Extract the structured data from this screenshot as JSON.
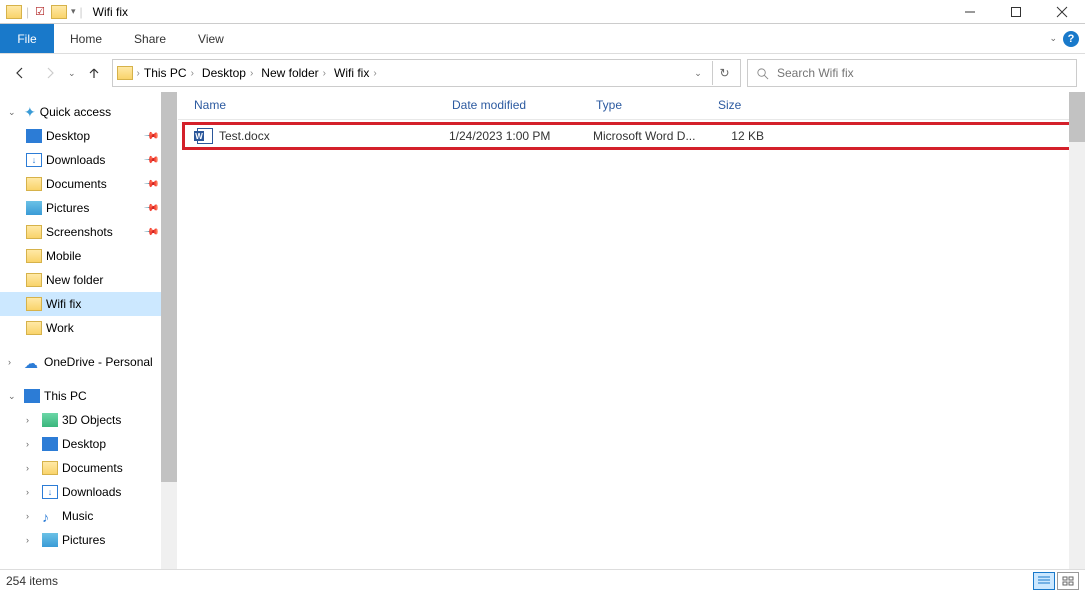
{
  "title": "Wifi fix",
  "ribbon": {
    "file": "File",
    "home": "Home",
    "share": "Share",
    "view": "View"
  },
  "breadcrumbs": [
    "This PC",
    "Desktop",
    "New folder",
    "Wifi fix"
  ],
  "search_placeholder": "Search Wifi fix",
  "columns": {
    "name": "Name",
    "date": "Date modified",
    "type": "Type",
    "size": "Size"
  },
  "files": [
    {
      "name": "Test.docx",
      "date": "1/24/2023 1:00 PM",
      "type": "Microsoft Word D...",
      "size": "12 KB"
    }
  ],
  "nav": {
    "quick_access": "Quick access",
    "qa": {
      "desktop": "Desktop",
      "downloads": "Downloads",
      "documents": "Documents",
      "pictures": "Pictures",
      "screenshots": "Screenshots",
      "mobile": "Mobile",
      "new_folder": "New folder",
      "wifi_fix": "Wifi fix",
      "work": "Work"
    },
    "onedrive": "OneDrive - Personal",
    "this_pc": "This PC",
    "pc": {
      "objects3d": "3D Objects",
      "desktop": "Desktop",
      "documents": "Documents",
      "downloads": "Downloads",
      "music": "Music",
      "pictures": "Pictures"
    }
  },
  "status": {
    "count": "254 items"
  }
}
